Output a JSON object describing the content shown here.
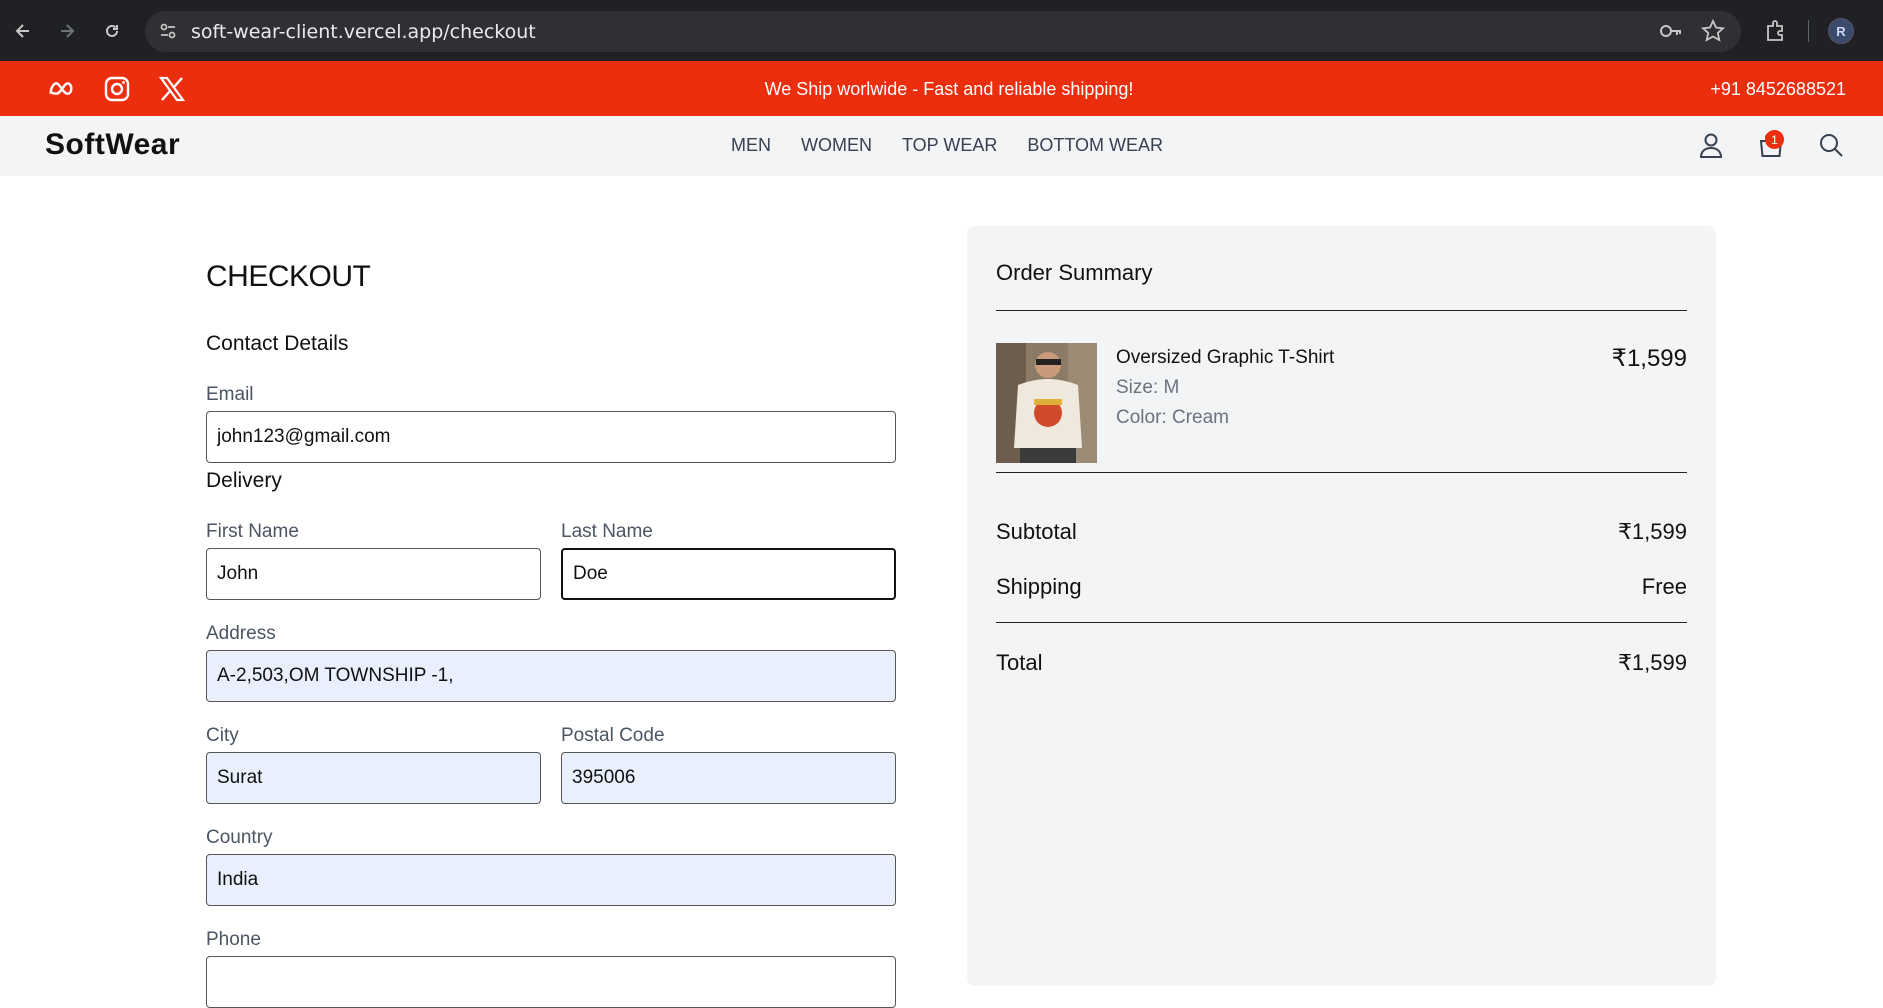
{
  "browser": {
    "url": "soft-wear-client.vercel.app/checkout",
    "profile_initial": "R"
  },
  "banner": {
    "message": "We Ship worlwide - Fast and reliable shipping!",
    "phone": "+91 8452688521",
    "icons": [
      "meta-icon",
      "instagram-icon",
      "x-twitter-icon"
    ]
  },
  "nav": {
    "logo": "SoftWear",
    "links": [
      "MEN",
      "WOMEN",
      "TOP WEAR",
      "BOTTOM WEAR"
    ],
    "cart_count": "1"
  },
  "checkout": {
    "title": "CHECKOUT",
    "contact_title": "Contact Details",
    "delivery_title": "Delivery",
    "email_label": "Email",
    "email_value": "john123@gmail.com",
    "first_name_label": "First Name",
    "first_name_value": "John",
    "last_name_label": "Last Name",
    "last_name_value": "Doe",
    "address_label": "Address",
    "address_value": "A-2,503,OM TOWNSHIP -1,",
    "city_label": "City",
    "city_value": "Surat",
    "postal_label": "Postal Code",
    "postal_value": "395006",
    "country_label": "Country",
    "country_value": "India",
    "phone_label": "Phone",
    "phone_value": ""
  },
  "summary": {
    "title": "Order Summary",
    "product": {
      "name": "Oversized Graphic T-Shirt",
      "size": "Size: M",
      "color": "Color: Cream",
      "price": "₹1,599"
    },
    "subtotal_label": "Subtotal",
    "subtotal_value": "₹1,599",
    "shipping_label": "Shipping",
    "shipping_value": "Free",
    "total_label": "Total",
    "total_value": "₹1,599"
  },
  "colors": {
    "banner": "#ea2e0e",
    "navbar": "#f3f4f6",
    "autofill": "#e8f0fe"
  }
}
